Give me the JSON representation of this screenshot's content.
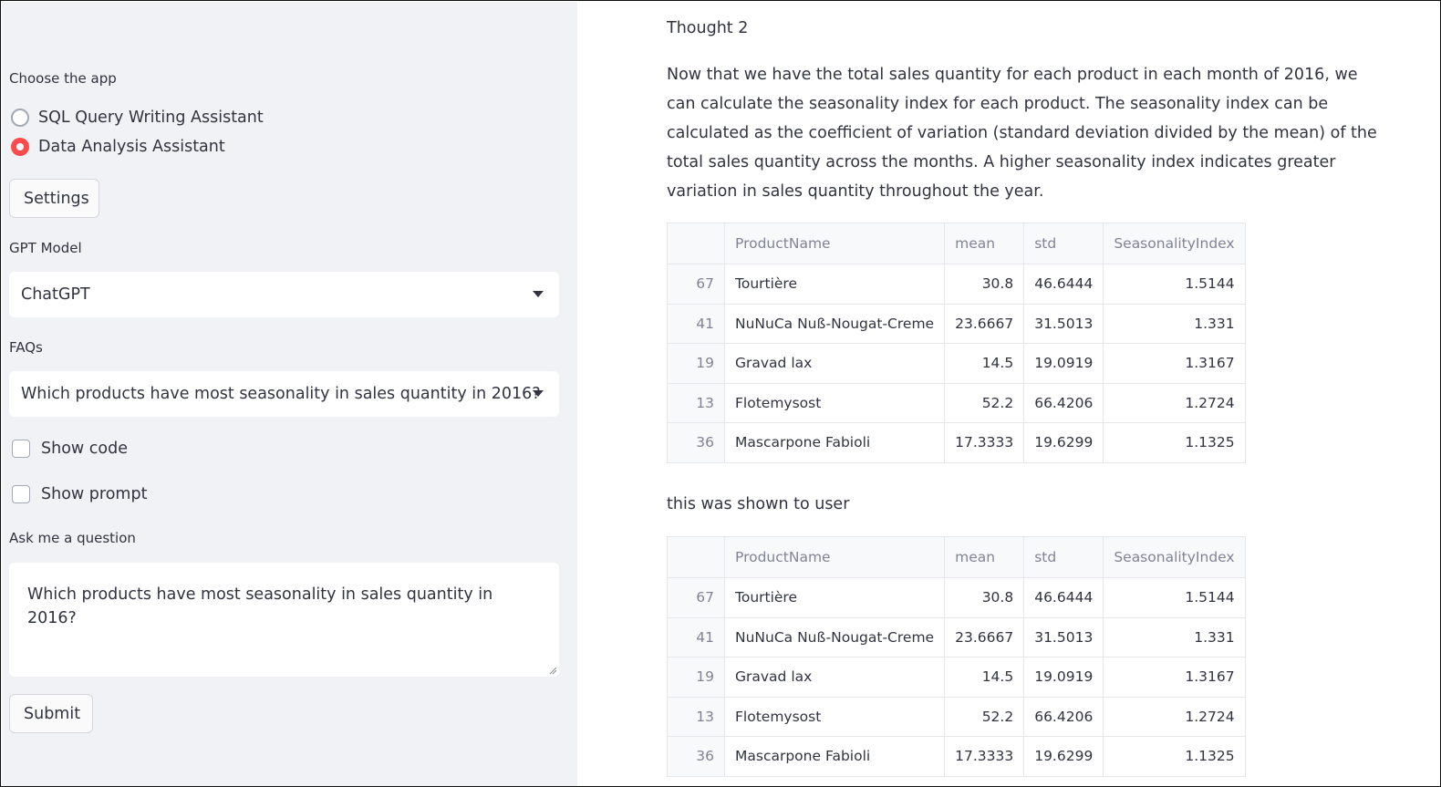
{
  "sidebar": {
    "choose_app_label": "Choose the app",
    "apps": [
      {
        "label": "SQL Query Writing Assistant",
        "checked": false
      },
      {
        "label": "Data Analysis Assistant",
        "checked": true
      }
    ],
    "settings_button": "Settings",
    "gpt_model_label": "GPT Model",
    "gpt_model_value": "ChatGPT",
    "faqs_label": "FAQs",
    "faqs_value": "Which products have most seasonality in sales quantity in 2016?",
    "show_code_label": "Show code",
    "show_prompt_label": "Show prompt",
    "ask_label": "Ask me a question",
    "question_value": "Which products have most seasonality in sales quantity in 2016?",
    "submit_button": "Submit"
  },
  "main": {
    "thought_title": "Thought 2",
    "thought_text": "Now that we have the total sales quantity for each product in each month of 2016, we can calculate the seasonality index for each product. The seasonality index can be calculated as the coefficient of variation (standard deviation divided by the mean) of the total sales quantity across the months. A higher seasonality index indicates greater variation in sales quantity throughout the year.",
    "shown_to_user_text": "this was shown to user",
    "table": {
      "columns": [
        "",
        "ProductName",
        "mean",
        "std",
        "SeasonalityIndex"
      ],
      "rows": [
        [
          "67",
          "Tourtière",
          "30.8",
          "46.6444",
          "1.5144"
        ],
        [
          "41",
          "NuNuCa Nuß-Nougat-Creme",
          "23.6667",
          "31.5013",
          "1.331"
        ],
        [
          "19",
          "Gravad lax",
          "14.5",
          "19.0919",
          "1.3167"
        ],
        [
          "13",
          "Flotemysost",
          "52.2",
          "66.4206",
          "1.2724"
        ],
        [
          "36",
          "Mascarpone Fabioli",
          "17.3333",
          "19.6299",
          "1.1325"
        ]
      ]
    }
  },
  "colors": {
    "sidebar_bg": "#f0f2f6",
    "accent": "#ff4b4b",
    "text": "#31333f",
    "muted": "#808495"
  }
}
